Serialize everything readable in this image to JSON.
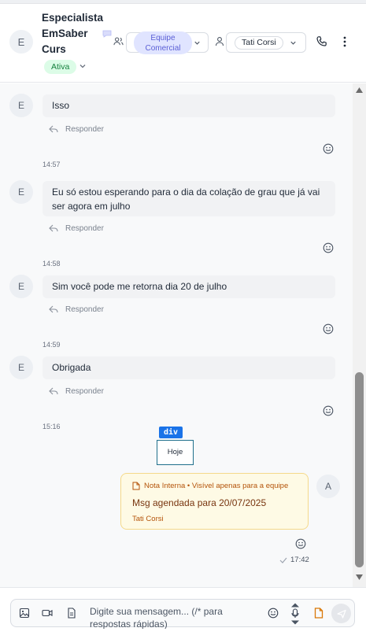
{
  "header": {
    "avatar_initial": "E",
    "contact_name": "Especialista EmSaber Curs",
    "status": "Ativa",
    "team": "Equipe Comercial",
    "agent": "Tati Corsi"
  },
  "messages": [
    {
      "avatar": "E",
      "text": "Isso",
      "reply_label": "Responder",
      "time": "14:57"
    },
    {
      "avatar": "E",
      "text": "Eu só estou esperando para o dia da colação de grau que já vai ser agora em julho",
      "reply_label": "Responder",
      "time": "14:58"
    },
    {
      "avatar": "E",
      "text": "Sim você pode me retorna dia 20 de julho",
      "reply_label": "Responder",
      "time": "14:59"
    },
    {
      "avatar": "E",
      "text": "Obrigada",
      "reply_label": "Responder",
      "time": "15:16"
    }
  ],
  "inspector_tag": "div",
  "day_separator": "Hoje",
  "internal_note": {
    "header": "Nota Interna • Visível apenas para a equipe",
    "text": "Msg agendada para 20/07/2025",
    "author": "Tati Corsi",
    "avatar": "A",
    "time": "17:42"
  },
  "composer": {
    "placeholder": "Digite sua mensagem... (/* para respostas rápidas)"
  },
  "colors": {
    "status_bg": "#dcfce7",
    "status_text": "#15803d",
    "team_pill": "#e0e4ff",
    "note_bg": "#fefae5",
    "note_border": "#f5d98a",
    "note_text": "#b45309",
    "inspector_tag": "#1a73e8"
  },
  "icons": [
    "chat-bubble-icon",
    "chevron-down-icon",
    "team-icon",
    "person-icon",
    "phone-icon",
    "more-vertical-icon",
    "reply-icon",
    "emoji-icon",
    "note-icon",
    "check-icon",
    "image-icon",
    "video-icon",
    "document-icon",
    "microphone-icon",
    "internal-note-icon",
    "send-icon"
  ]
}
